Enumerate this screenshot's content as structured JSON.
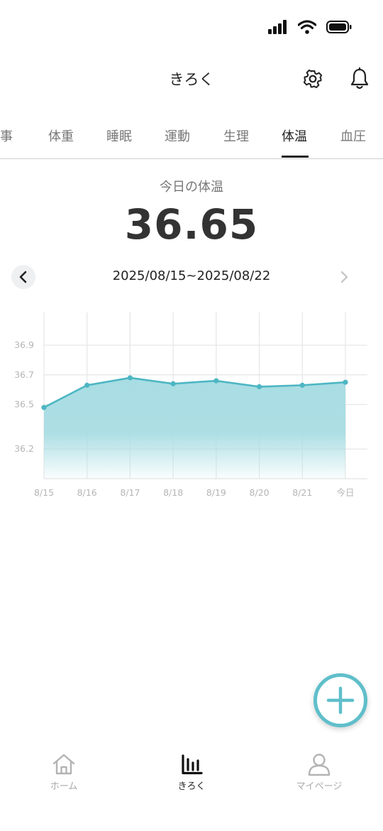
{
  "header": {
    "title": "きろく"
  },
  "tabs": [
    {
      "label": "食事"
    },
    {
      "label": "体重"
    },
    {
      "label": "睡眠"
    },
    {
      "label": "運動"
    },
    {
      "label": "生理"
    },
    {
      "label": "体温",
      "active": true
    },
    {
      "label": "血圧"
    }
  ],
  "summary": {
    "label": "今日の体温",
    "value": "36.65"
  },
  "range": {
    "text": "2025/08/15~2025/08/22"
  },
  "chart_data": {
    "type": "area",
    "x": [
      "8/15",
      "8/16",
      "8/17",
      "8/18",
      "8/19",
      "8/20",
      "8/21",
      "今日"
    ],
    "series": [
      {
        "values": [
          36.48,
          36.63,
          36.68,
          36.64,
          36.66,
          36.62,
          36.63,
          36.65
        ]
      }
    ],
    "yticks": [
      "36.9",
      "36.7",
      "36.5",
      "36.2"
    ],
    "ylim": [
      36.0,
      37.12
    ],
    "grid": true,
    "colors": {
      "line": "#4db6c3",
      "fill": "#a8dde3"
    }
  },
  "fab": {
    "icon": "plus-icon"
  },
  "bottom_nav": [
    {
      "label": "ホーム",
      "icon": "home-icon"
    },
    {
      "label": "きろく",
      "icon": "chart-bars-icon",
      "active": true
    },
    {
      "label": "マイページ",
      "icon": "person-icon"
    }
  ]
}
